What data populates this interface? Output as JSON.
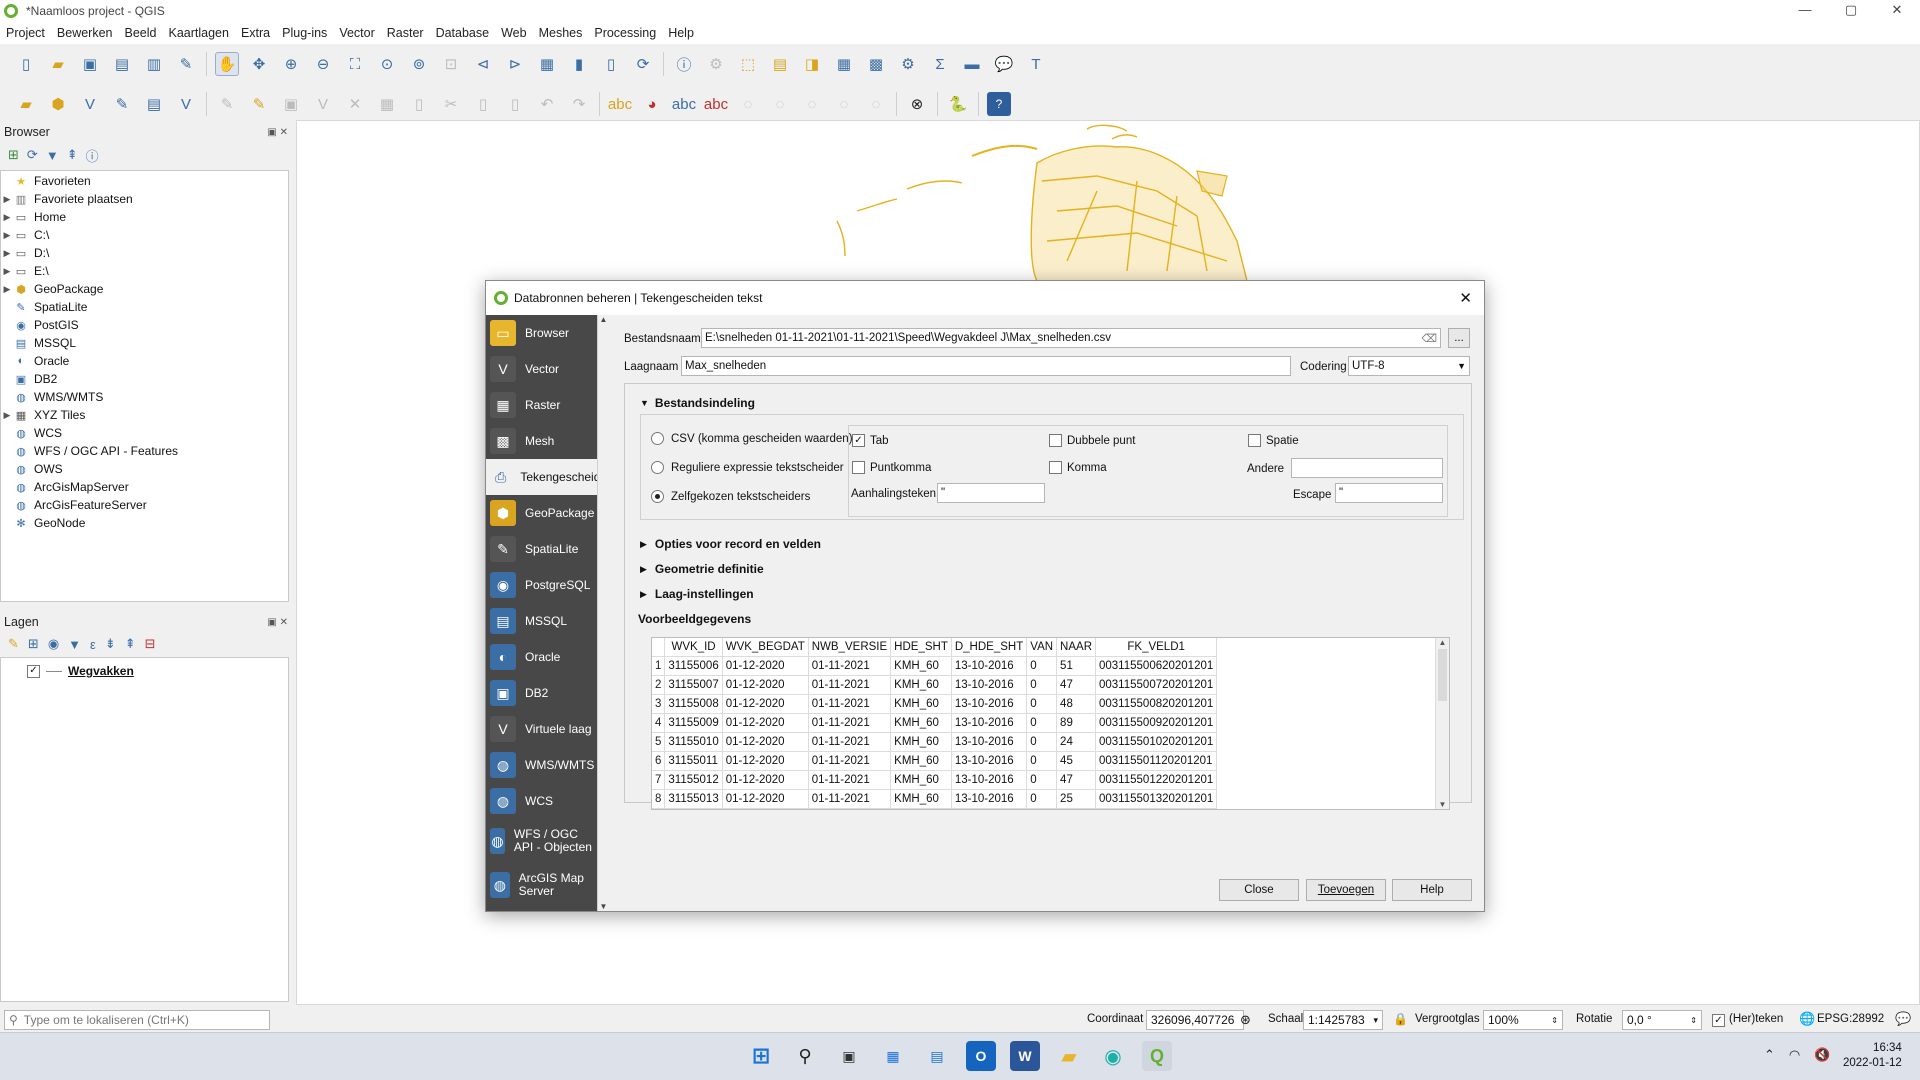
{
  "app": {
    "title": "*Naamloos project - QGIS",
    "window_controls": [
      "—",
      "▢",
      "✕"
    ]
  },
  "menu": [
    "Project",
    "Bewerken",
    "Beeld",
    "Kaartlagen",
    "Extra",
    "Plug-ins",
    "Vector",
    "Raster",
    "Database",
    "Web",
    "Meshes",
    "Processing",
    "Help"
  ],
  "browser_panel": {
    "title": "Browser",
    "items": [
      {
        "label": "Favorieten",
        "icon": "star-icon",
        "expand": false
      },
      {
        "label": "Favoriete plaatsen",
        "icon": "bookmarks-icon",
        "expand": true
      },
      {
        "label": "Home",
        "icon": "folder-icon",
        "expand": true
      },
      {
        "label": "C:\\",
        "icon": "folder-icon",
        "expand": true
      },
      {
        "label": "D:\\",
        "icon": "folder-icon",
        "expand": true
      },
      {
        "label": "E:\\",
        "icon": "folder-icon",
        "expand": true
      },
      {
        "label": "GeoPackage",
        "icon": "geopackage-icon",
        "expand": true
      },
      {
        "label": "SpatiaLite",
        "icon": "spatialite-icon",
        "expand": false
      },
      {
        "label": "PostGIS",
        "icon": "postgis-icon",
        "expand": false
      },
      {
        "label": "MSSQL",
        "icon": "mssql-icon",
        "expand": false
      },
      {
        "label": "Oracle",
        "icon": "oracle-icon",
        "expand": false
      },
      {
        "label": "DB2",
        "icon": "db2-icon",
        "expand": false
      },
      {
        "label": "WMS/WMTS",
        "icon": "globe-icon",
        "expand": false
      },
      {
        "label": "XYZ Tiles",
        "icon": "xyz-icon",
        "expand": true
      },
      {
        "label": "WCS",
        "icon": "globe-icon",
        "expand": false
      },
      {
        "label": "WFS / OGC API - Features",
        "icon": "globe-icon",
        "expand": false
      },
      {
        "label": "OWS",
        "icon": "globe-icon",
        "expand": false
      },
      {
        "label": "ArcGisMapServer",
        "icon": "globe-icon",
        "expand": false
      },
      {
        "label": "ArcGisFeatureServer",
        "icon": "globe-icon",
        "expand": false
      },
      {
        "label": "GeoNode",
        "icon": "geonode-icon",
        "expand": false
      }
    ]
  },
  "layers_panel": {
    "title": "Lagen",
    "layers": [
      {
        "label": "Wegvakken",
        "checked": true
      }
    ]
  },
  "statusbar": {
    "locator_placeholder": "Type om te lokaliseren (Ctrl+K)",
    "coord_label": "Coordinaat",
    "coord_value": "326096,407726",
    "scale_label": "Schaal",
    "scale_value": "1:1425783",
    "magnifier_label": "Vergrootglas",
    "magnifier_value": "100%",
    "rotation_label": "Rotatie",
    "rotation_value": "0,0 °",
    "render_label": "(Her)teken",
    "crs": "EPSG:28992"
  },
  "taskbar": {
    "time": "16:34",
    "date": "2022-01-12"
  },
  "dialog": {
    "title": "Databronnen beheren | Tekengescheiden tekst",
    "sidebar": [
      {
        "label": "Browser",
        "icon": "folder-icon"
      },
      {
        "label": "Vector",
        "icon": "vector-icon"
      },
      {
        "label": "Raster",
        "icon": "raster-icon"
      },
      {
        "label": "Mesh",
        "icon": "mesh-icon"
      },
      {
        "label": "Tekengescheiden",
        "icon": "delimited-text-icon",
        "selected": true
      },
      {
        "label": "GeoPackage",
        "icon": "geopackage-icon"
      },
      {
        "label": "SpatiaLite",
        "icon": "spatialite-icon"
      },
      {
        "label": "PostgreSQL",
        "icon": "postgis-icon"
      },
      {
        "label": "MSSQL",
        "icon": "mssql-icon"
      },
      {
        "label": "Oracle",
        "icon": "oracle-icon"
      },
      {
        "label": "DB2",
        "icon": "db2-icon"
      },
      {
        "label": "Virtuele laag",
        "icon": "virtual-layer-icon"
      },
      {
        "label": "WMS/WMTS",
        "icon": "globe-icon"
      },
      {
        "label": "WCS",
        "icon": "globe-icon"
      },
      {
        "label": "WFS / OGC API - Objecten",
        "icon": "globe-icon"
      },
      {
        "label": "ArcGIS Map Server",
        "icon": "globe-icon"
      }
    ],
    "filename_label": "Bestandsnaam",
    "filename_value": "E:\\snelheden 01-11-2021\\01-11-2021\\Speed\\Wegvakdeel J\\Max_snelheden.csv",
    "browse_label": "...",
    "layername_label": "Laagnaam",
    "layername_value": "Max_snelheden",
    "encoding_label": "Codering",
    "encoding_value": "UTF-8",
    "format_group": "Bestandsindeling",
    "radio_csv": "CSV (komma gescheiden waarden)",
    "radio_regex": "Reguliere expressie tekstscheider",
    "radio_custom": "Zelfgekozen tekstscheiders",
    "chk_tab": "Tab",
    "chk_colon": "Dubbele punt",
    "chk_space": "Spatie",
    "chk_semicolon": "Puntkomma",
    "chk_comma": "Komma",
    "other_label": "Andere",
    "quote_label": "Aanhalingsteken",
    "quote_value": "\"",
    "escape_label": "Escape",
    "escape_value": "\"",
    "options_group": "Opties voor record en velden",
    "geometry_group": "Geometrie definitie",
    "layer_settings_group": "Laag-instellingen",
    "sample_data_label": "Voorbeeldgegevens",
    "columns": [
      "WVK_ID",
      "WVK_BEGDAT",
      "NWB_VERSIE",
      "HDE_SHT",
      "D_HDE_SHT",
      "VAN",
      "NAAR",
      "FK_VELD1"
    ],
    "rows": [
      [
        "1",
        "31155006",
        "01-12-2020",
        "01-11-2021",
        "KMH_60",
        "13-10-2016",
        "0",
        "51",
        "003115500620201201"
      ],
      [
        "2",
        "31155007",
        "01-12-2020",
        "01-11-2021",
        "KMH_60",
        "13-10-2016",
        "0",
        "47",
        "003115500720201201"
      ],
      [
        "3",
        "31155008",
        "01-12-2020",
        "01-11-2021",
        "KMH_60",
        "13-10-2016",
        "0",
        "48",
        "003115500820201201"
      ],
      [
        "4",
        "31155009",
        "01-12-2020",
        "01-11-2021",
        "KMH_60",
        "13-10-2016",
        "0",
        "89",
        "003115500920201201"
      ],
      [
        "5",
        "31155010",
        "01-12-2020",
        "01-11-2021",
        "KMH_60",
        "13-10-2016",
        "0",
        "24",
        "003115501020201201"
      ],
      [
        "6",
        "31155011",
        "01-12-2020",
        "01-11-2021",
        "KMH_60",
        "13-10-2016",
        "0",
        "45",
        "003115501120201201"
      ],
      [
        "7",
        "31155012",
        "01-12-2020",
        "01-11-2021",
        "KMH_60",
        "13-10-2016",
        "0",
        "47",
        "003115501220201201"
      ],
      [
        "8",
        "31155013",
        "01-12-2020",
        "01-11-2021",
        "KMH_60",
        "13-10-2016",
        "0",
        "25",
        "003115501320201201"
      ]
    ],
    "btn_close": "Close",
    "btn_add": "Toevoegen",
    "btn_help": "Help"
  },
  "colors": {
    "map_features": "#e5b21d",
    "sidebar_bg": "#484848",
    "qgis_green": "#66b030"
  }
}
